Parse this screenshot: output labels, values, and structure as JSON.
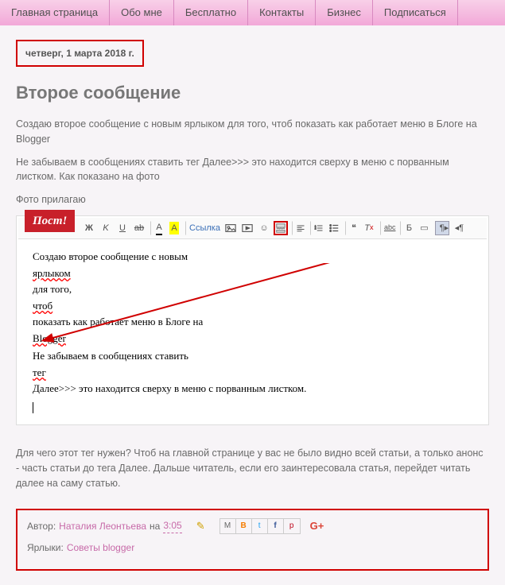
{
  "nav": {
    "items": [
      "Главная страница",
      "Обо мне",
      "Бесплатно",
      "Контакты",
      "Бизнес",
      "Подписаться"
    ]
  },
  "post": {
    "date": "четверг, 1 марта 2018 г.",
    "title": "Второе сообщение",
    "p1": "Создаю второе сообщение с новым ярлыком для того, чтоб показать как работает меню в Блоге на Blogger",
    "p2": "Не забываем в сообщениях ставить тег Далее>>> это находится сверху в меню с порванным листком. Как показано на фото",
    "p3": "Фото прилагаю",
    "p4": "Для чего этот тег нужен? Чтоб на главной странице у вас не было видно всей статьи, а только анонс - часть статьи до тега Далее. Дальше читатель, если его заинтересовала статья, перейдет читать далее на саму статью."
  },
  "editor": {
    "badge": "Пост!",
    "link_label": "Ссылка",
    "line1a": "Создаю второе сообщение с новым ",
    "line1b": "ярлыком",
    "line1c": " для того, ",
    "line1d": "чтоб",
    "line1e": " показать как работает меню в Блоге на ",
    "line1f": "Blogger",
    "line2a": "Не забываем в сообщениях ставить ",
    "line2b": "тег",
    "line2c": " Далее>>> это находится сверху в меню с порванным листком.",
    "icons": {
      "bold": "Ж",
      "italic": "K",
      "underline": "U",
      "strike": "S",
      "fgcolor": "A",
      "bgcolor": "A",
      "image": "img",
      "video": "vid",
      "smile": "☺",
      "jump": "jump",
      "alignleft": "L",
      "list1": "•",
      "list2": "1",
      "quote": "❝",
      "clear": "Тх",
      "spell": "abc",
      "b2": "Б",
      "box": "□",
      "arrow": "▶"
    }
  },
  "meta": {
    "author_label": "Автор: ",
    "author": "Наталия Леонтьева",
    "at": " на ",
    "time": "3:05",
    "labels_label": "Ярлыки: ",
    "label1": "Советы blogger",
    "gplus": "G+"
  }
}
